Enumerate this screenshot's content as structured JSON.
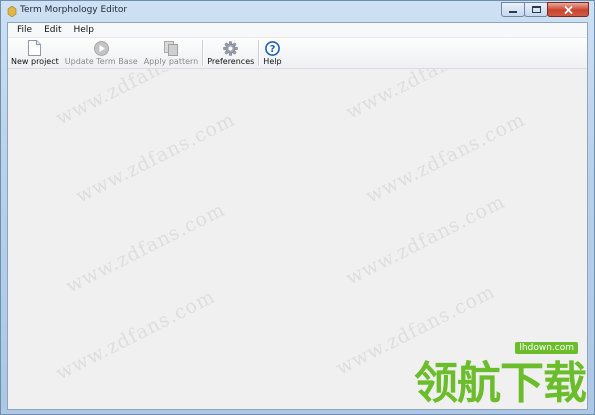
{
  "window": {
    "title": "Term Morphology Editor"
  },
  "menubar": {
    "items": [
      {
        "id": "file",
        "label": "File"
      },
      {
        "id": "edit",
        "label": "Edit"
      },
      {
        "id": "help",
        "label": "Help"
      }
    ]
  },
  "toolbar": {
    "new_project": {
      "label": "New project",
      "icon": "new-document-icon",
      "enabled": true
    },
    "update_term_base": {
      "label": "Update Term Base",
      "icon": "play-icon",
      "enabled": false
    },
    "apply_pattern": {
      "label": "Apply pattern",
      "icon": "copy-pages-icon",
      "enabled": false
    },
    "preferences": {
      "label": "Preferences",
      "icon": "gear-icon",
      "enabled": true
    },
    "help": {
      "label": "Help",
      "icon": "question-circle-icon",
      "enabled": true
    }
  },
  "watermark": {
    "text": "www.zdfans.com"
  },
  "brand": {
    "text": "领航下载",
    "url": "lhdown.com",
    "color": "#6bbd2b"
  }
}
